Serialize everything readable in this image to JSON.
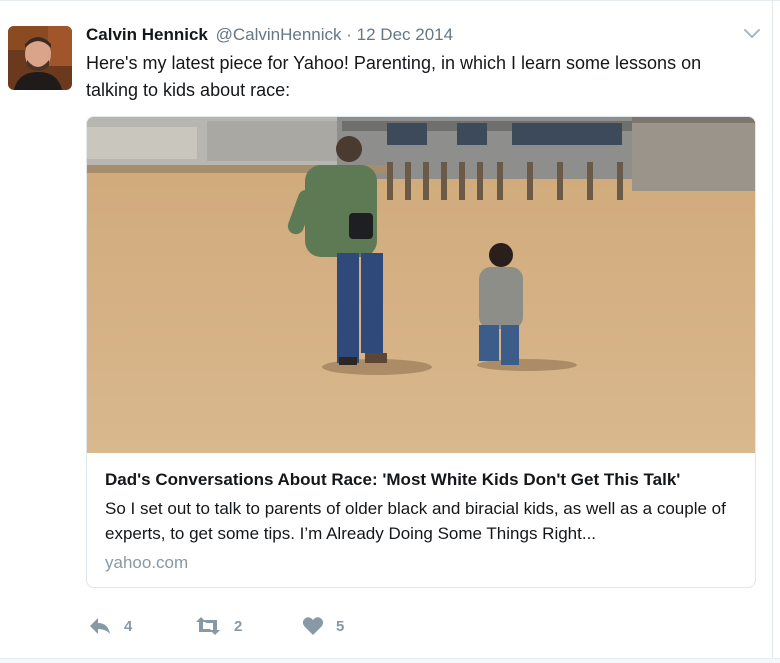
{
  "tweet": {
    "author_name": "Calvin Hennick",
    "handle": "@CalvinHennick",
    "separator": "·",
    "timestamp": "12 Dec 2014",
    "text": "Here's my latest piece for Yahoo! Parenting, in which I learn some lessons on talking to kids about race:"
  },
  "card": {
    "image_icon": "beach-photo",
    "title": "Dad's Conversations About Race: 'Most White Kids Don't Get This Talk'",
    "description": "So I set out to talk to parents of older black and biracial kids, as well as a couple of experts, to get some tips. I’m Already Doing Some Things Right...",
    "domain": "yahoo.com"
  },
  "actions": {
    "reply": {
      "icon": "reply-icon",
      "count": "4"
    },
    "retweet": {
      "icon": "retweet-icon",
      "count": "2"
    },
    "like": {
      "icon": "heart-icon",
      "count": "5"
    }
  },
  "colors": {
    "text": "#14171a",
    "secondary": "#657786",
    "muted": "#8899a6",
    "border": "#e1e8ed"
  }
}
